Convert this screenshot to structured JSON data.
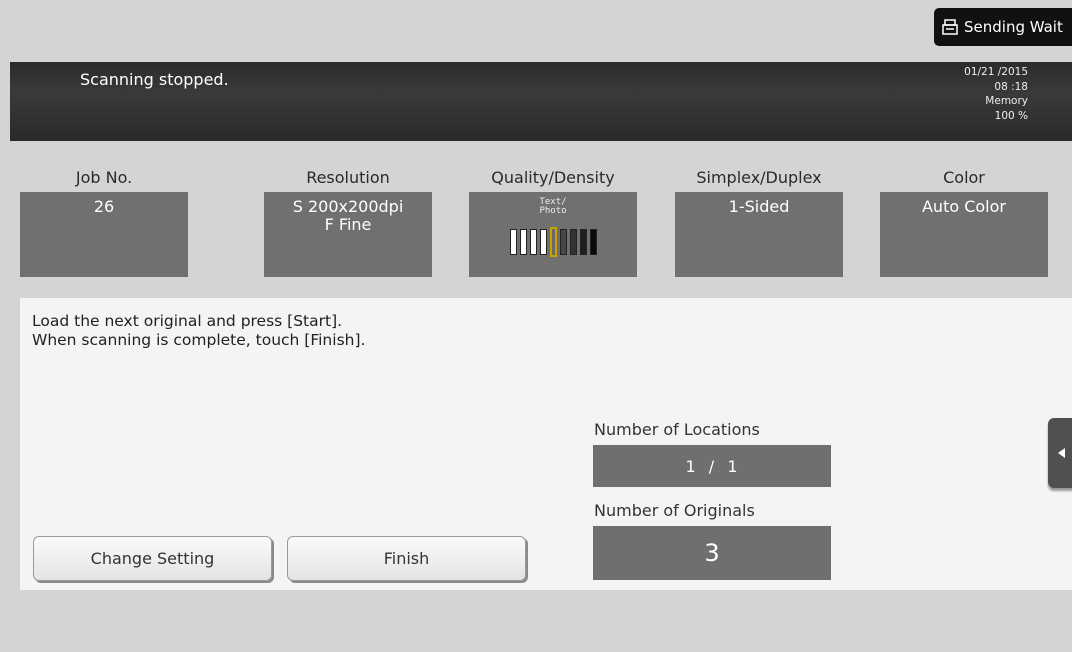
{
  "top_status": {
    "label": "Sending Wait",
    "icon": "fax-icon"
  },
  "header": {
    "status": "Scanning stopped.",
    "date": "01/21 /2015",
    "time": "08 :18",
    "memory_label": "Memory",
    "memory_value": "100 %"
  },
  "settings": {
    "job_no": {
      "label": "Job No.",
      "value": "26"
    },
    "resolution": {
      "label": "Resolution",
      "line1": "S 200x200dpi",
      "line2": "F Fine"
    },
    "quality": {
      "label": "Quality/Density",
      "mode_line1": "Text/",
      "mode_line2": "Photo",
      "density_level": 5,
      "density_steps": 9
    },
    "duplex": {
      "label": "Simplex/Duplex",
      "value": "1-Sided"
    },
    "color": {
      "label": "Color",
      "value": "Auto Color"
    }
  },
  "instructions": {
    "line1": "Load the next original and press [Start].",
    "line2": "When scanning is complete, touch [Finish]."
  },
  "buttons": {
    "change_setting": "Change Setting",
    "finish": "Finish"
  },
  "counts": {
    "locations_label": "Number of Locations",
    "locations_value": "1  /  1",
    "originals_label": "Number of Originals",
    "originals_value": "3"
  },
  "colors": {
    "header_bg": "#2b2b2b",
    "box_bg": "#707070",
    "density_selected": "#c8a200"
  }
}
